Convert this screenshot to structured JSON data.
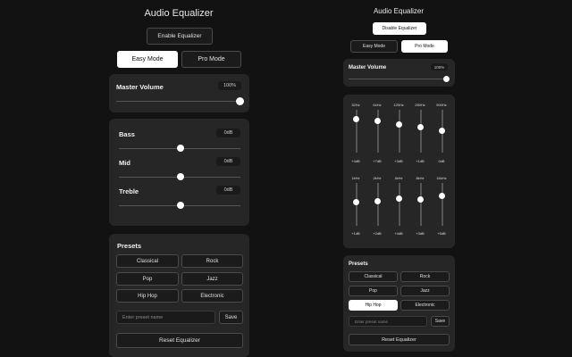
{
  "left": {
    "title": "Audio Equalizer",
    "enable_label": "Enable Equalizer",
    "modes": [
      "Easy Mode",
      "Pro Mode"
    ],
    "master": {
      "label": "Master Volume",
      "value": "100%",
      "level": 1.0
    },
    "bands": [
      {
        "label": "Bass",
        "value": "0dB",
        "level": 0.5
      },
      {
        "label": "Mid",
        "value": "0dB",
        "level": 0.5
      },
      {
        "label": "Treble",
        "value": "0dB",
        "level": 0.5
      }
    ],
    "presets": {
      "title": "Presets",
      "items": [
        "Classical",
        "Rock",
        "Pop",
        "Jazz",
        "Hip Hop",
        "Electronic"
      ],
      "placeholder": "Enter preset name",
      "save_label": "Save",
      "reset_label": "Reset Equalizer"
    }
  },
  "right": {
    "title": "Audio Equalizer",
    "disable_label": "Disable Equalizer",
    "modes": [
      "Easy Mode",
      "Pro Mode"
    ],
    "master": {
      "label": "Master Volume",
      "value": "100%",
      "level": 1.0
    },
    "pro_bands": [
      {
        "freq": "32Hz",
        "value": "+4dB",
        "level": 0.6
      },
      {
        "freq": "64Hz",
        "value": "+7dB",
        "level": 0.65
      },
      {
        "freq": "125Hz",
        "value": "+3dB",
        "level": 0.55
      },
      {
        "freq": "250Hz",
        "value": "+1dB",
        "level": 0.5
      },
      {
        "freq": "500Hz",
        "value": "0dB",
        "level": 0.45
      },
      {
        "freq": "1kHz",
        "value": "+1dB",
        "level": 0.5
      },
      {
        "freq": "2kHz",
        "value": "+2dB",
        "level": 0.55
      },
      {
        "freq": "4kHz",
        "value": "+4dB",
        "level": 0.6
      },
      {
        "freq": "8kHz",
        "value": "+3dB",
        "level": 0.55
      },
      {
        "freq": "16kHz",
        "value": "+5dB",
        "level": 0.6
      }
    ],
    "presets": {
      "title": "Presets",
      "items": [
        "Classical",
        "Rock",
        "Pop",
        "Jazz",
        "Hip Hop",
        "Electronic"
      ],
      "active": "Hip Hop",
      "placeholder": "Enter preset name",
      "save_label": "Save",
      "reset_label": "Reset Equalizer"
    }
  }
}
